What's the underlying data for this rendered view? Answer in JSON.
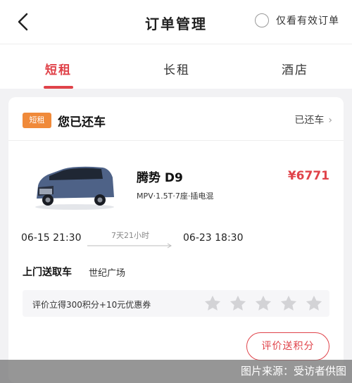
{
  "header": {
    "title": "订单管理",
    "valid_only_label": "仅看有效订单"
  },
  "tabs": [
    {
      "label": "短租",
      "active": true
    },
    {
      "label": "长租",
      "active": false
    },
    {
      "label": "酒店",
      "active": false
    }
  ],
  "order": {
    "tag": "短租",
    "status_title": "您已还车",
    "status_link": "已还车",
    "car": {
      "name": "腾势 D9",
      "spec": "MPV·1.5T·7座·插电混",
      "price": "¥6771",
      "image": "car-icon"
    },
    "pickup_time": "06-15 21:30",
    "return_time": "06-23 18:30",
    "duration": "7天21小时",
    "service_label": "上门送取车",
    "service_value": "世纪广场",
    "rating_prompt": "评价立得300积分+10元优惠券",
    "stars": 5,
    "rate_button": "评价送积分"
  },
  "watermark": "图片来源：受访者供图",
  "colors": {
    "accent": "#e0434a",
    "tag_bg": "#f08a3a"
  }
}
